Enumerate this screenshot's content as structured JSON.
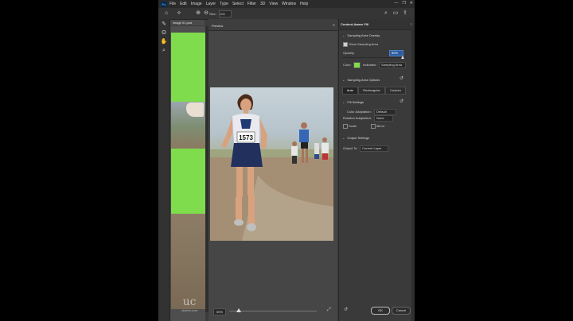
{
  "app": {
    "logo": "Ps",
    "menu": [
      "File",
      "Edit",
      "Image",
      "Layer",
      "Type",
      "Select",
      "Filter",
      "3D",
      "View",
      "Window",
      "Help"
    ],
    "window_controls": [
      "—",
      "❐",
      "✕"
    ]
  },
  "options_bar": {
    "size_label": "Size:",
    "size_value": "100"
  },
  "document": {
    "tab_label": "image 01.psd"
  },
  "preview": {
    "title": "Preview",
    "close": "≡",
    "zoom_value": "50%",
    "bib_number": "1573"
  },
  "panel": {
    "title": "Content-Aware Fill",
    "menu": "≡",
    "sampling_overlay": {
      "header": "Sampling Area Overlay",
      "show_label": "Show Sampling Area",
      "show_checked": true,
      "opacity_label": "Opacity:",
      "opacity_value": "50%",
      "opacity_fraction": 0.5,
      "color_label": "Color:",
      "color": "#7fdc4c",
      "indicates_label": "Indicates:",
      "indicates_value": "Sampling Area"
    },
    "sampling_options": {
      "header": "Sampling Area Options",
      "buttons": [
        "Auto",
        "Rectangular",
        "Custom"
      ],
      "active": "Auto"
    },
    "fill_settings": {
      "header": "Fill Settings",
      "color_adaptation_label": "Color Adaptation:",
      "color_adaptation_value": "Default",
      "rotation_adaptation_label": "Rotation Adaptation:",
      "rotation_adaptation_value": "None",
      "scale_label": "Scale",
      "mirror_label": "Mirror"
    },
    "output_settings": {
      "header": "Output Settings",
      "output_to_label": "Output To:",
      "output_to_value": "Current Layer"
    },
    "ok_label": "OK",
    "cancel_label": "Cancel"
  },
  "watermark": {
    "mark": "uc",
    "site": "ukdebi.com"
  },
  "colors": {
    "accent_blue": "#2d5d9e",
    "overlay_green": "#7fdc4c",
    "ps_blue": "#31a8ff"
  }
}
